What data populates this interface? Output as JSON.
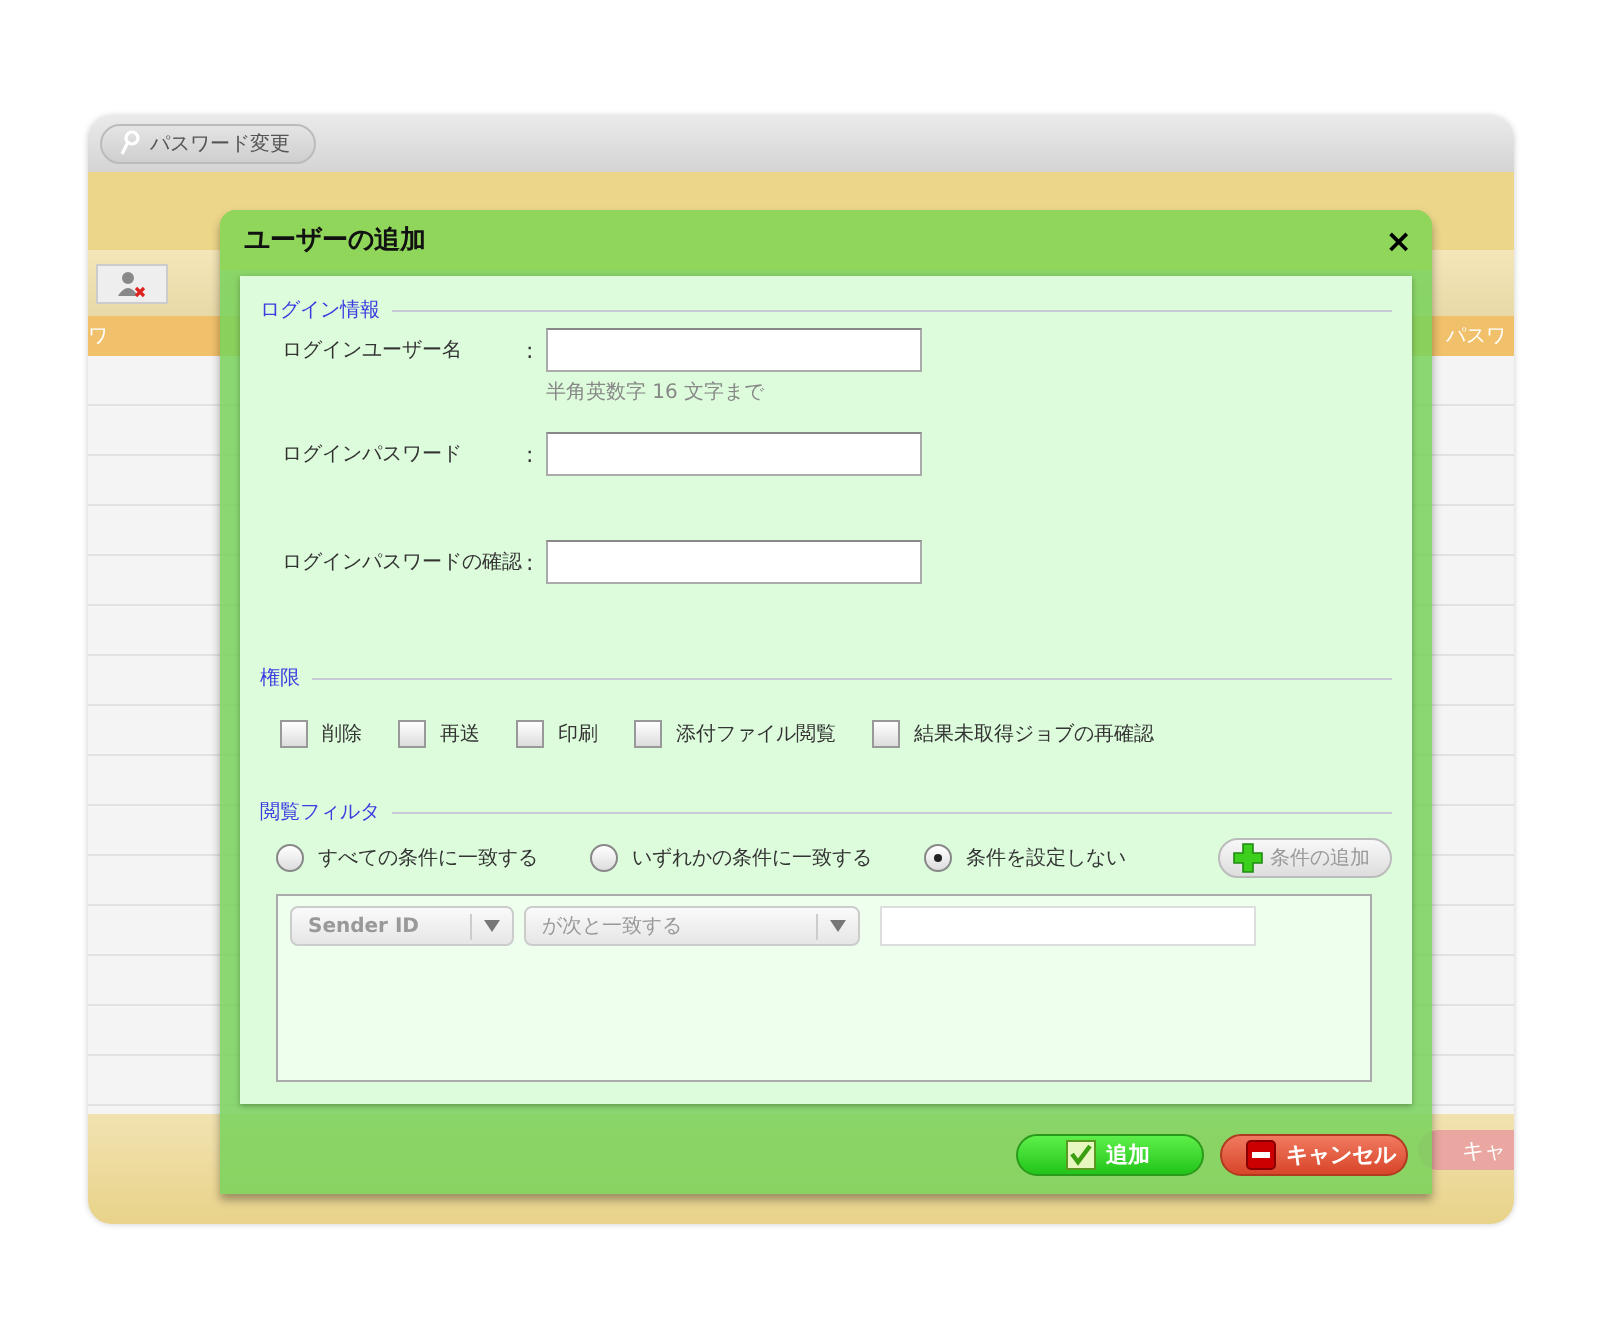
{
  "background": {
    "toolbar_button": "パスワード変更",
    "header_left": "ワ",
    "header_right": "パスワ",
    "cancel_partial": "キャ"
  },
  "dialog": {
    "title": "ユーザーの追加",
    "close": "×",
    "login": {
      "heading": "ログイン情報",
      "fields": [
        {
          "label": "ログインユーザー名",
          "separator": ":",
          "hint": "半角英数字 16 文字まで"
        },
        {
          "label": "ログインパスワード",
          "separator": ":"
        },
        {
          "label": "ログインパスワードの確認",
          "separator": ":"
        }
      ]
    },
    "permissions": {
      "heading": "権限",
      "items": [
        {
          "label": "削除",
          "checked": false
        },
        {
          "label": "再送",
          "checked": false
        },
        {
          "label": "印刷",
          "checked": false
        },
        {
          "label": "添付ファイル閲覧",
          "checked": false
        },
        {
          "label": "結果未取得ジョブの再確認",
          "checked": false
        }
      ]
    },
    "filter": {
      "heading": "閲覧フィルタ",
      "options": [
        {
          "label": "すべての条件に一致する",
          "selected": false
        },
        {
          "label": "いずれかの条件に一致する",
          "selected": false
        },
        {
          "label": "条件を設定しない",
          "selected": true
        }
      ],
      "add_button": "条件の追加",
      "condition": {
        "field": "Sender ID",
        "operator": "が次と一致する"
      }
    },
    "buttons": [
      {
        "label": "追加",
        "kind": "ok"
      },
      {
        "label": "キャンセル",
        "kind": "cancel"
      }
    ]
  }
}
